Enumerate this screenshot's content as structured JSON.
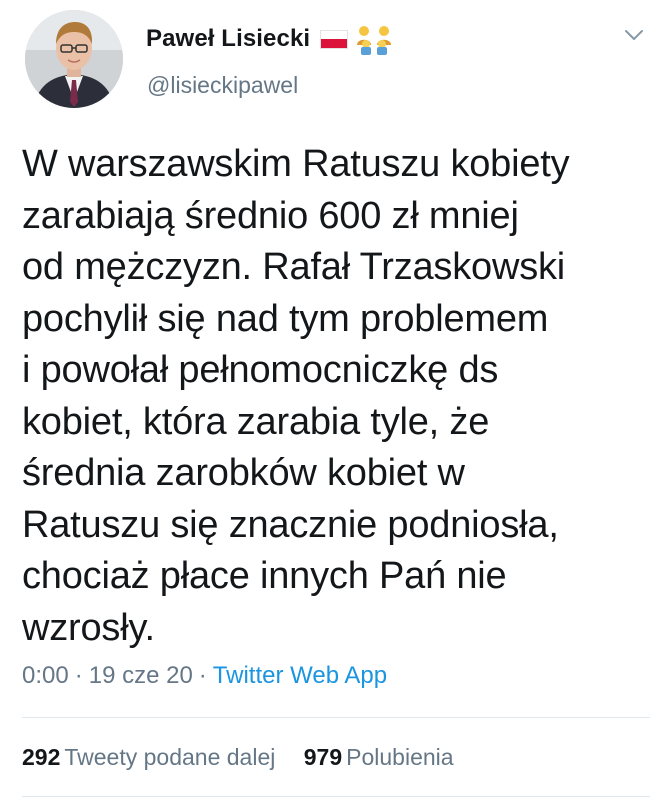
{
  "author": {
    "display_name": "Paweł Lisiecki",
    "handle": "@lisieckipawel",
    "emoji": [
      "poland-flag-icon",
      "family-icon"
    ]
  },
  "tweet": {
    "text": "W warszawskim Ratuszu kobiety\nzarabiają średnio 600 zł mniej\nod mężczyzn. Rafał Trzaskowski\npochylił się nad tym problemem\ni powołał pełnomocniczkę ds\nkobiet, która zarabia tyle, że\nśrednia zarobków kobiet w\nRatuszu się znacznie podniosła,\nchociaż płace innych Pań nie\nwzrosły."
  },
  "meta": {
    "time": "0:00",
    "date": "19 cze 20",
    "separator": "·",
    "source": "Twitter Web App"
  },
  "stats": {
    "retweets_count": "292",
    "retweets_label": "Tweety podane dalej",
    "likes_count": "979",
    "likes_label": "Polubienia"
  },
  "colors": {
    "text": "#14171a",
    "secondary": "#657786",
    "link": "#1b95e0",
    "divider": "#e1e8ed"
  }
}
